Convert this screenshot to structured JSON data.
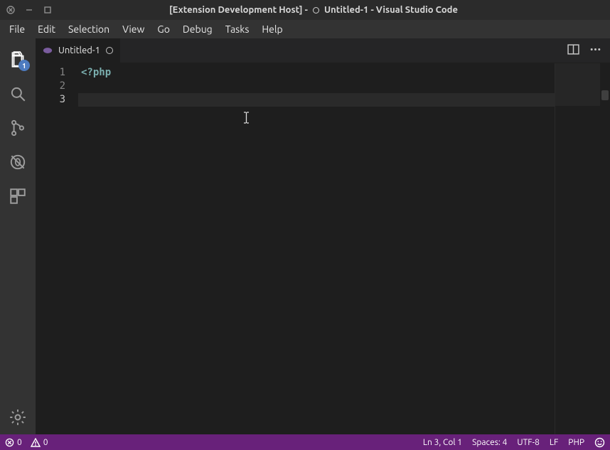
{
  "window": {
    "title_prefix": "[Extension Development Host] - ",
    "title_file": "Untitled-1",
    "title_suffix": " - Visual Studio Code"
  },
  "menubar": {
    "items": [
      "File",
      "Edit",
      "Selection",
      "View",
      "Go",
      "Debug",
      "Tasks",
      "Help"
    ]
  },
  "activitybar": {
    "explorer_badge": "1"
  },
  "tab": {
    "label": "Untitled-1"
  },
  "editor": {
    "lines": {
      "l1_num": "1",
      "l2_num": "2",
      "l3_num": "3",
      "l1_text": "<?php"
    }
  },
  "statusbar": {
    "errors": "0",
    "warnings": "0",
    "cursor": "Ln 3, Col 1",
    "spaces": "Spaces: 4",
    "encoding": "UTF-8",
    "eol": "LF",
    "language": "PHP"
  }
}
